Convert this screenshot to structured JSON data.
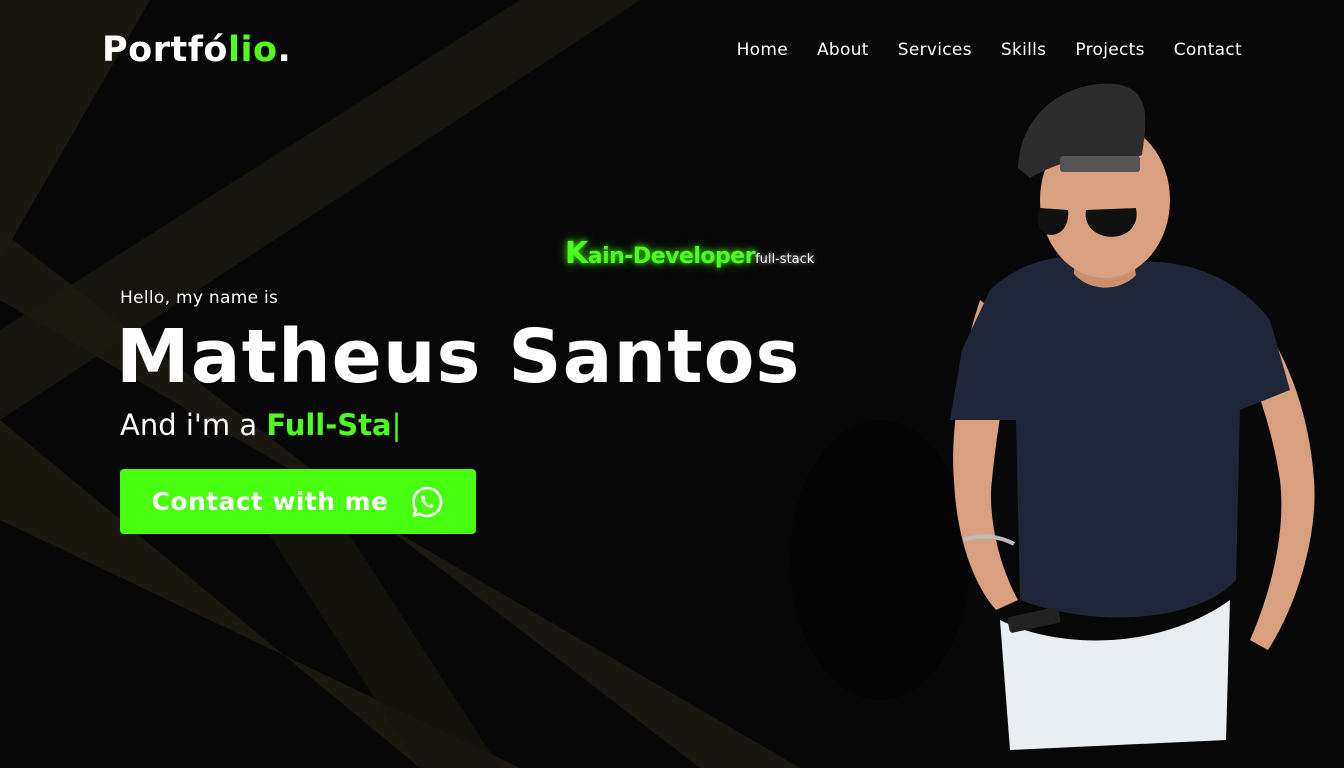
{
  "header": {
    "logo_main": "Portfó",
    "logo_accent": "lio",
    "logo_dot": ".",
    "nav": [
      {
        "label": "Home"
      },
      {
        "label": "About"
      },
      {
        "label": "Services"
      },
      {
        "label": "Skills"
      },
      {
        "label": "Projects"
      },
      {
        "label": "Contact"
      }
    ]
  },
  "brand": {
    "initial": "K",
    "rest": "ain-Developer",
    "sub": "full-stack"
  },
  "hero": {
    "greeting": "Hello, my name is",
    "name": "Matheus Santos",
    "role_prefix": "And i'm a ",
    "role_typed": "Full-Sta",
    "caret": "|",
    "cta_label": "Contact with me",
    "cta_icon": "whatsapp-icon"
  },
  "colors": {
    "accent": "#4dff1a",
    "background": "#070707",
    "button": "#47ff0f"
  }
}
